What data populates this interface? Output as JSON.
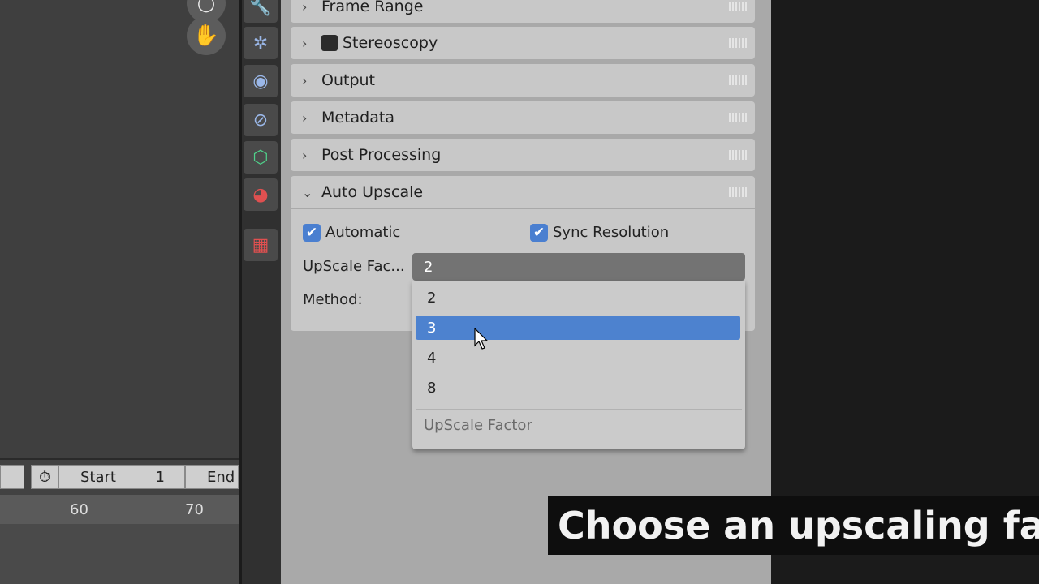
{
  "viewport": {
    "nav_buttons": [
      "circle-icon",
      "hand-icon"
    ]
  },
  "timeline": {
    "start_label": "Start",
    "start_value": "1",
    "end_label": "End",
    "ruler_ticks": [
      "60",
      "70"
    ]
  },
  "tabs": [
    "wrench-icon",
    "particles-icon",
    "physics-icon",
    "constraints-icon",
    "object-data-icon",
    "material-icon",
    "texture-icon"
  ],
  "panels": [
    {
      "label": "Frame Range",
      "expanded": false
    },
    {
      "label": "Stereoscopy",
      "expanded": false,
      "has_checkbox": true
    },
    {
      "label": "Output",
      "expanded": false
    },
    {
      "label": "Metadata",
      "expanded": false
    },
    {
      "label": "Post Processing",
      "expanded": false
    },
    {
      "label": "Auto Upscale",
      "expanded": true
    }
  ],
  "auto_upscale": {
    "automatic_label": "Automatic",
    "automatic_checked": true,
    "sync_label": "Sync Resolution",
    "sync_checked": true,
    "factor_label": "UpScale Fac...",
    "factor_value": "2",
    "method_label": "Method:"
  },
  "dropdown": {
    "options": [
      "2",
      "3",
      "4",
      "8"
    ],
    "hovered": "3",
    "title": "UpScale Factor"
  },
  "caption": "Choose an upscaling factor",
  "colors": {
    "accent": "#4d82cf",
    "checkbox": "#4a7fd0",
    "panel": "#c8c8c8",
    "caption_bg": "#0e0e0e"
  }
}
